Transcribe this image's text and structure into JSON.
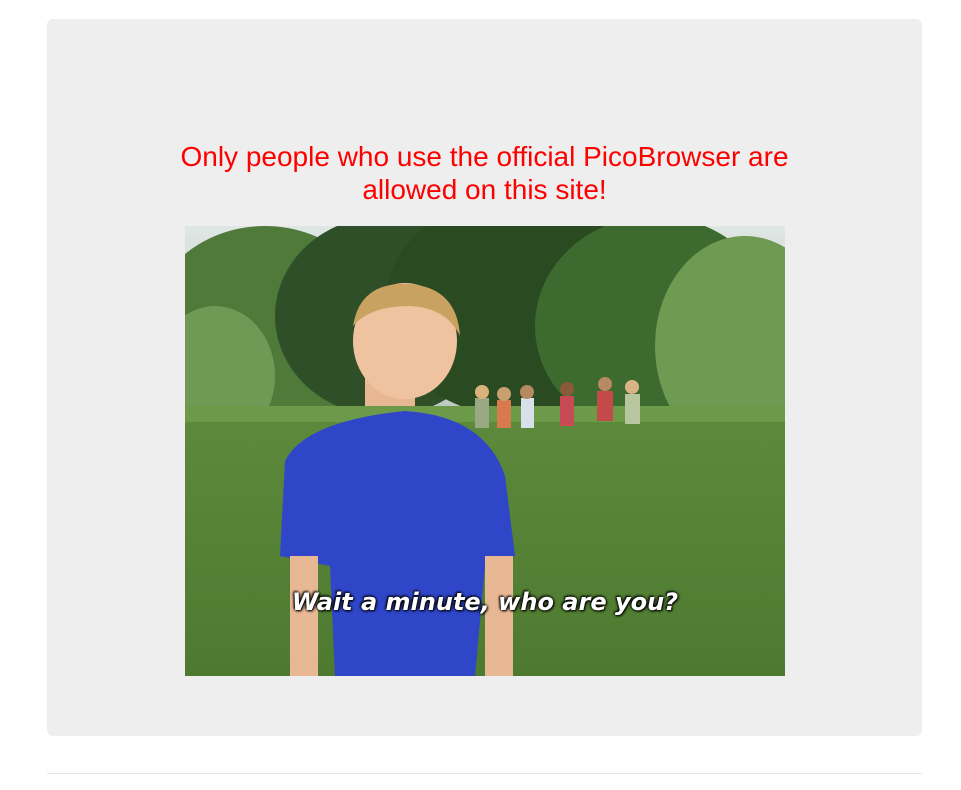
{
  "message": {
    "line1": "Only people who use the official PicoBrowser are",
    "line2": "allowed on this site!",
    "color": "#ff0000"
  },
  "gif": {
    "caption": "Wait a minute, who are you?",
    "alt": "Wait a minute, who are you?"
  },
  "colors": {
    "panel": "#eeeeee",
    "divider": "#e5e5e5"
  }
}
